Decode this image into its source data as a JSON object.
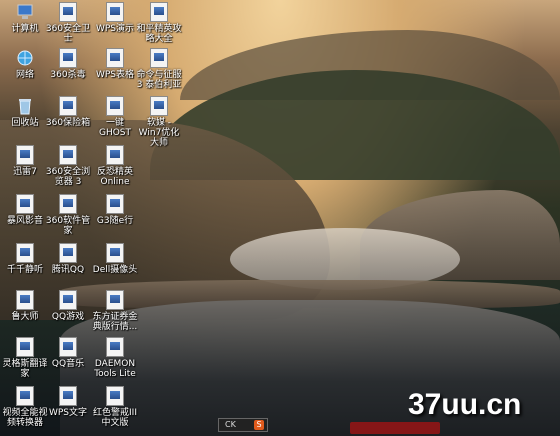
{
  "desktop": {
    "icons": [
      {
        "label": "计算机",
        "icon": "computer-icon",
        "system": true
      },
      {
        "label": "360安全卫士",
        "icon": "shortcut-icon"
      },
      {
        "label": "WPS演示",
        "icon": "shortcut-icon"
      },
      {
        "label": "和平精英攻略大全",
        "icon": "shortcut-icon"
      },
      {
        "label": "网络",
        "icon": "network-icon",
        "system": true
      },
      {
        "label": "360杀毒",
        "icon": "shortcut-icon"
      },
      {
        "label": "WPS表格",
        "icon": "shortcut-icon"
      },
      {
        "label": "命令与征服3 泰伯利亚",
        "icon": "shortcut-icon"
      },
      {
        "label": "回收站",
        "icon": "recycle-bin-icon",
        "system": true
      },
      {
        "label": "360保险箱",
        "icon": "shortcut-icon"
      },
      {
        "label": "一键GHOST",
        "icon": "shortcut-icon"
      },
      {
        "label": "软媒 - Win7优化大师",
        "icon": "shortcut-icon"
      },
      {
        "label": "迅雷7",
        "icon": "shortcut-icon"
      },
      {
        "label": "360安全浏览器 3",
        "icon": "shortcut-icon"
      },
      {
        "label": "反恐精英 Online",
        "icon": "shortcut-icon"
      },
      {
        "label": "暴风影音",
        "icon": "shortcut-icon"
      },
      {
        "label": "360软件管家",
        "icon": "shortcut-icon"
      },
      {
        "label": "G3随e行",
        "icon": "shortcut-icon"
      },
      {
        "label": "千千静听",
        "icon": "shortcut-icon"
      },
      {
        "label": "腾讯QQ",
        "icon": "shortcut-icon"
      },
      {
        "label": "Dell摄像头",
        "icon": "shortcut-icon"
      },
      {
        "label": "鲁大师",
        "icon": "shortcut-icon"
      },
      {
        "label": "QQ游戏",
        "icon": "shortcut-icon"
      },
      {
        "label": "东方证券金典版行情...",
        "icon": "shortcut-icon"
      },
      {
        "label": "灵格斯翻译家",
        "icon": "shortcut-icon"
      },
      {
        "label": "QQ音乐",
        "icon": "shortcut-icon"
      },
      {
        "label": "DAEMON Tools Lite",
        "icon": "shortcut-icon"
      },
      {
        "label": "视频全能视频转换器",
        "icon": "shortcut-icon"
      },
      {
        "label": "WPS文字",
        "icon": "shortcut-icon"
      },
      {
        "label": "红色警戒III 中文版",
        "icon": "shortcut-icon"
      }
    ]
  },
  "taskbar": {
    "widget_label": "CK",
    "widget_badge": "S"
  },
  "watermark": "37uu.cn"
}
